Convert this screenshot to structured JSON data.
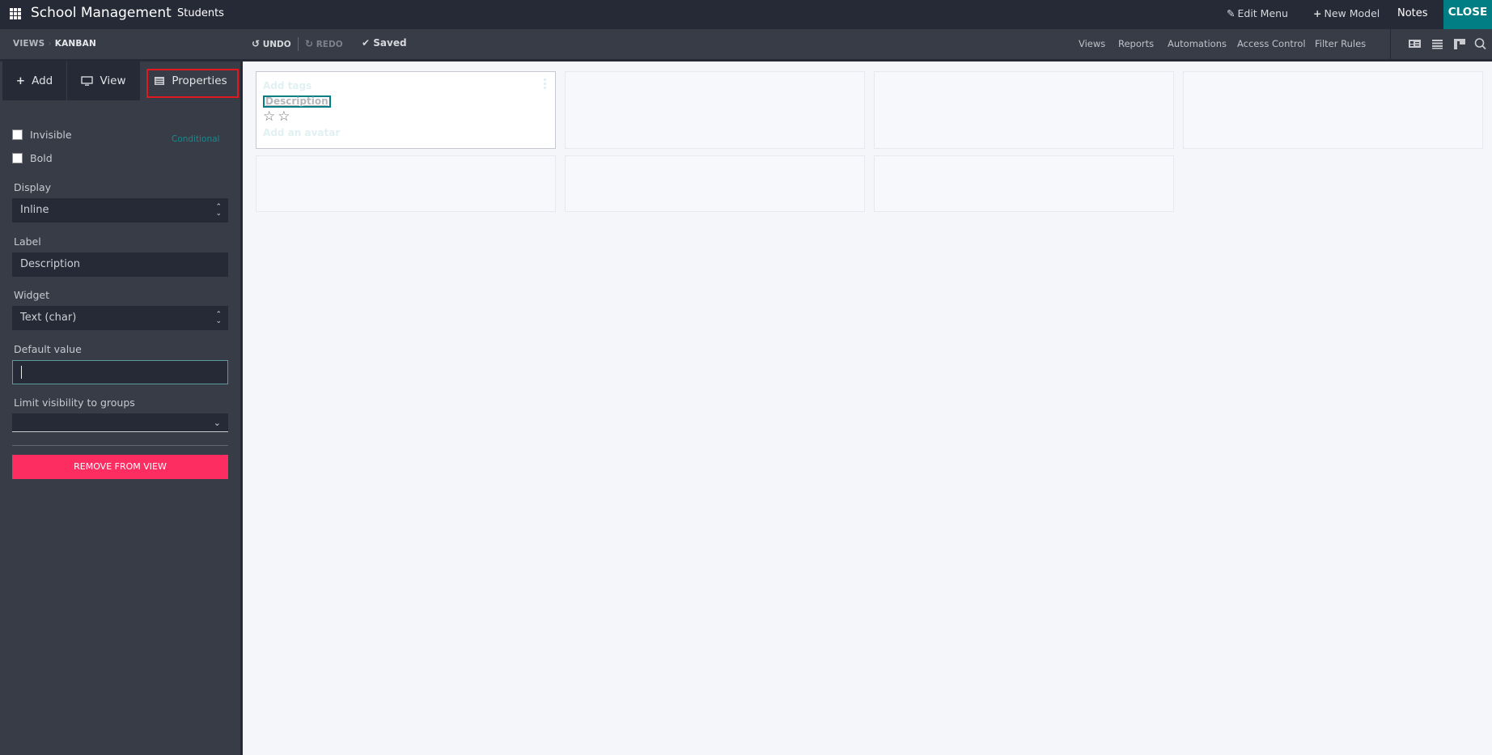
{
  "header": {
    "app_title": "School Management",
    "menu_item": "Students",
    "edit_menu": "Edit Menu",
    "new_model": "New Model",
    "notes": "Notes",
    "close": "CLOSE",
    "edit_menu_icon": "pencil-icon",
    "new_model_icon": "plus-icon"
  },
  "toolbar": {
    "breadcrumb": [
      "VIEWS",
      "KANBAN"
    ],
    "undo": "UNDO",
    "redo": "REDO",
    "saved": "Saved",
    "links": [
      "Views",
      "Reports",
      "Automations",
      "Access Control",
      "Filter Rules"
    ],
    "view_icons": [
      "form-view-icon",
      "list-view-icon",
      "kanban-view-icon",
      "search-icon"
    ]
  },
  "sidebar": {
    "tabs": [
      {
        "label": "Add",
        "icon": "plus-icon"
      },
      {
        "label": "View",
        "icon": "monitor-icon"
      },
      {
        "label": "Properties",
        "icon": "properties-icon",
        "active": true
      }
    ],
    "checkboxes": [
      {
        "label": "Invisible",
        "checked": false
      },
      {
        "label": "Bold",
        "checked": false
      }
    ],
    "conditional": "Conditional",
    "display": {
      "label": "Display",
      "value": "Inline"
    },
    "label_field": {
      "label": "Label",
      "value": "Description"
    },
    "widget": {
      "label": "Widget",
      "value": "Text (char)"
    },
    "default_value": {
      "label": "Default value",
      "value": ""
    },
    "groups": {
      "label": "Limit visibility to groups",
      "value": ""
    },
    "remove_button": "REMOVE FROM VIEW"
  },
  "kanban": {
    "card": {
      "tags_placeholder": "Add tags",
      "description": "Description",
      "stars": "☆☆",
      "avatar_placeholder": "Add an avatar"
    },
    "ghost_cards": 6
  }
}
